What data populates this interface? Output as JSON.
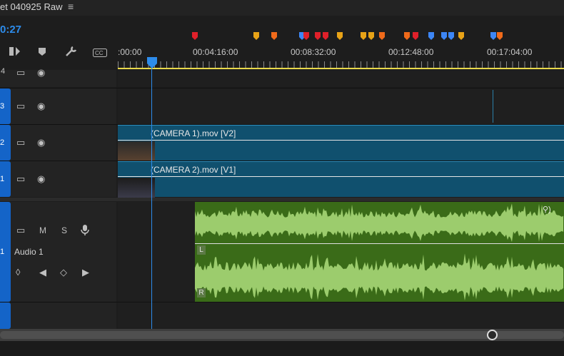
{
  "header": {
    "sequence_title": "et 040925 Raw",
    "menu_icon": "hamburger-menu-icon",
    "current_timecode": "0:27"
  },
  "toolbar": {
    "icons": [
      "snap-icon",
      "add-marker-icon",
      "wrench-icon",
      "captions-icon"
    ]
  },
  "ruler": {
    "timecodes": [
      ":00:00",
      "00:04:16:00",
      "00:08:32:00",
      "00:12:48:00",
      "00:17:04:00"
    ]
  },
  "markers": [
    {
      "color": "#e0202a"
    },
    {
      "color": "#e8a317"
    },
    {
      "color": "#f06a1a"
    },
    {
      "color": "#3d86f5"
    },
    {
      "color": "#e0202a"
    },
    {
      "color": "#e0202a"
    },
    {
      "color": "#e0202a"
    },
    {
      "color": "#e8a317"
    },
    {
      "color": "#e8a317"
    },
    {
      "color": "#e8a317"
    },
    {
      "color": "#f06a1a"
    },
    {
      "color": "#f06a1a"
    },
    {
      "color": "#e0202a"
    },
    {
      "color": "#3d86f5"
    },
    {
      "color": "#3d86f5"
    },
    {
      "color": "#3d86f5"
    },
    {
      "color": "#e8a317"
    },
    {
      "color": "#3d86f5"
    },
    {
      "color": "#f06a1a"
    }
  ],
  "tracks": {
    "v4": {
      "label": "4"
    },
    "v3": {
      "label": "3"
    },
    "v2": {
      "label": "2",
      "clip_name": "(CAMERA 1).mov [V2]"
    },
    "v1": {
      "label": "1",
      "clip_name": "(CAMERA 2).mov [V1]"
    },
    "a1": {
      "label": "1",
      "name": "Audio 1",
      "mute": "M",
      "solo": "S",
      "left_channel": "L",
      "right_channel": "R"
    }
  },
  "colors": {
    "accent": "#2d8ceb",
    "video_clip": "#10506e",
    "audio_clip": "#3a6b18",
    "waveform": "#9ccc6d",
    "track_tab": "#1464c8",
    "work_area": "#e8d84a"
  }
}
